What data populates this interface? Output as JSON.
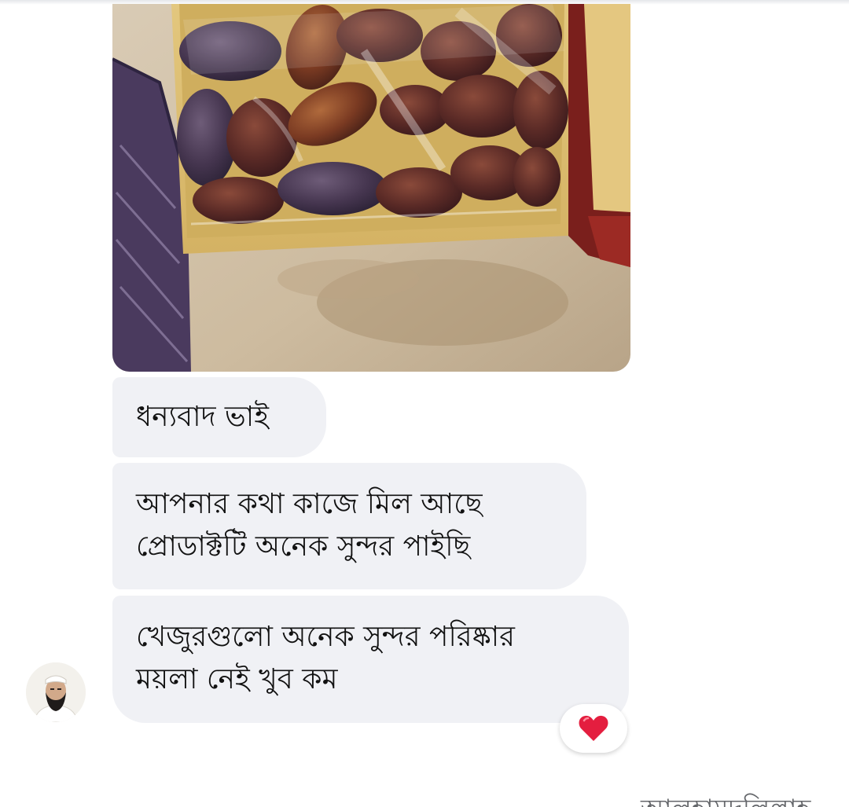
{
  "conversation": {
    "messages": [
      {
        "lines": [
          "ধন্যবাদ ভাই"
        ]
      },
      {
        "lines": [
          "আপনার কথা কাজে মিল আছে",
          "প্রোডাক্টটি অনেক সুন্দর পাইছি"
        ]
      },
      {
        "lines": [
          "খেজুরগুলো অনেক সুন্দর পরিষ্কার",
          "ময়লা নেই খুব কম"
        ]
      }
    ],
    "reaction": {
      "icon": "heart-icon",
      "color": "#e41e3f"
    },
    "next_text_cut": "আলহামদুলিল্লাহ"
  },
  "colors": {
    "bubble_bg": "#f0f1f5",
    "text": "#111111",
    "background": "#ffffff"
  }
}
